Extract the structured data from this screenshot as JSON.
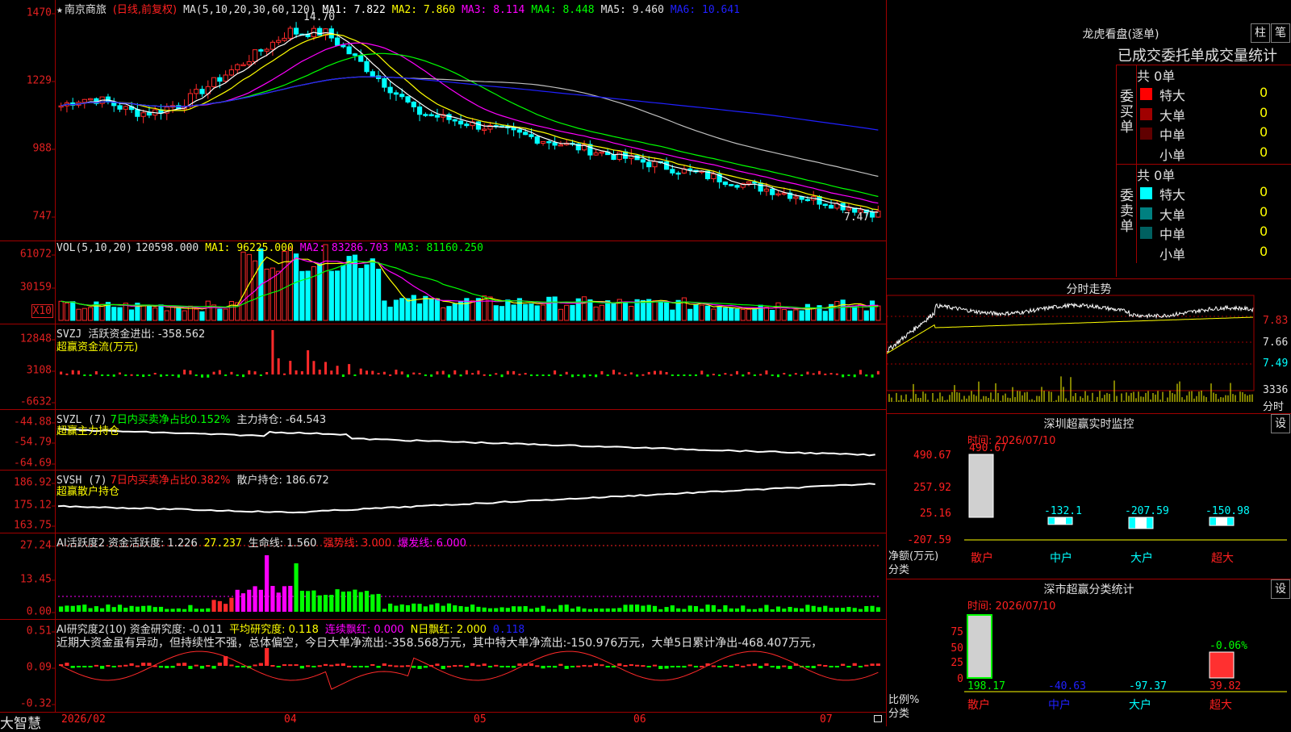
{
  "colors": {
    "up": "#ff2a2a",
    "down": "#00ffff",
    "ma1": "#ffffff",
    "ma2": "#ffff00",
    "ma3": "#ff00ff",
    "ma4": "#00ff00",
    "ma5": "#c0c0c0",
    "ma6": "#2020ff",
    "frame": "#a00000"
  },
  "main": {
    "stock_name": "南京商旅",
    "period": "(日线,前复权)",
    "ma_label": "MA(5,10,20,30,60,120)",
    "ma1": "MA1: 7.822",
    "ma2": "MA2: 7.860",
    "ma3": "MA3: 8.114",
    "ma4": "MA4: 8.448",
    "ma5": "MA5: 9.460",
    "ma6": "MA6: 10.641",
    "high_label": "14.70",
    "low_label": "7.47",
    "ticks": [
      "1470",
      "1229",
      "988",
      "747"
    ]
  },
  "vol": {
    "title": "VOL(5,10,20)",
    "value": "120598.000",
    "ma1": "MA1: 96225.000",
    "ma2": "MA2: 83286.703",
    "ma3": "MA3: 81160.250",
    "ticks": [
      "61072",
      "30159"
    ],
    "unit": "X10"
  },
  "svzj": {
    "title": "SVZJ",
    "line": "活跃资金进出: -358.562",
    "sub": "超赢资金流(万元)",
    "ticks": [
      "12848",
      "3108",
      "-6632"
    ]
  },
  "svzl": {
    "title": "SVZL (7)",
    "ratio": "7日内买卖净占比0.152%",
    "line": "主力持仓: -64.543",
    "sub": "超赢主力持仓",
    "ticks": [
      "-44.88",
      "-54.79",
      "-64.69"
    ]
  },
  "svsh": {
    "title": "SVSH (7)",
    "ratio": "7日内买卖净占比0.382%",
    "line": "散户持仓: 186.672",
    "sub": "超赢散户持仓",
    "ticks": [
      "186.92",
      "175.12",
      "163.75"
    ]
  },
  "ai1": {
    "title": "AI活跃度2",
    "v1": "资金活跃度: 1.226",
    "v2": "27.237",
    "v3": "生命线: 1.560",
    "v4": "强势线: 3.000",
    "v5": "爆发线: 6.000",
    "ticks": [
      "27.24",
      "13.45",
      "0.00"
    ]
  },
  "ai2": {
    "title": "AI研究度2(10)",
    "v1": "资金研究度: -0.011",
    "v2": "平均研究度: 0.118",
    "v3": "连续飘红: 0.000",
    "v4": "N日飘红: 2.000",
    "v5": "0.118",
    "comment": "近期大资金虽有异动，但持续性不强，总体偏空，今日大单净流出:-358.568万元，其中特大单净流出:-150.976万元，大单5日累计净出-468.407万元，",
    "ticks": [
      "0.51",
      "0.09",
      "-0.32"
    ]
  },
  "xaxis": [
    "2026/02",
    "04",
    "05",
    "06",
    "07"
  ],
  "brand": "大智慧",
  "lhb": {
    "title": "龙虎看盘(逐单)",
    "btn1": "柱",
    "btn2": "笔",
    "subtitle": "已成交委托单成交量统计",
    "buy_label": "委买单",
    "sell_label": "委卖单",
    "buy_total": "共 0单",
    "sell_total": "共 0单",
    "buy_rows": [
      {
        "cat": "特大",
        "cnt": "0",
        "pct": "0%",
        "color": "#ff0000"
      },
      {
        "cat": "大单",
        "cnt": "0",
        "pct": "0%",
        "color": "#a00000"
      },
      {
        "cat": "中单",
        "cnt": "0",
        "pct": "0%",
        "color": "#600000"
      },
      {
        "cat": "小单",
        "cnt": "0",
        "pct": "0%",
        "color": "#000000"
      }
    ],
    "sell_rows": [
      {
        "cat": "特大",
        "cnt": "0",
        "pct": "0%",
        "color": "#00ffff"
      },
      {
        "cat": "大单",
        "cnt": "0",
        "pct": "0%",
        "color": "#008080"
      },
      {
        "cat": "中单",
        "cnt": "0",
        "pct": "0%",
        "color": "#006060"
      },
      {
        "cat": "小单",
        "cnt": "0",
        "pct": "0%",
        "color": "#000000"
      }
    ]
  },
  "fenshi": {
    "title": "分时走势",
    "ticks": [
      "7.83",
      "7.66",
      "7.49",
      "3336"
    ],
    "unit": "分时"
  },
  "monitor": {
    "title": "深圳超赢实时监控",
    "btn": "设",
    "time": "时间: 2026/07/10",
    "ticks": [
      "490.67",
      "257.92",
      "25.16",
      "-207.59"
    ],
    "ylabel1": "净额(万元)",
    "ylabel2": "分类",
    "bars": [
      {
        "cat": "散户",
        "value": "490.67",
        "num": 490.67
      },
      {
        "cat": "中户",
        "value": "-132.1",
        "num": -132.1
      },
      {
        "cat": "大户",
        "value": "-207.59",
        "num": -207.59
      },
      {
        "cat": "超大",
        "value": "-150.98",
        "num": -150.98
      }
    ]
  },
  "classify": {
    "title": "深市超赢分类统计",
    "btn": "设",
    "time": "时间: 2026/07/10",
    "ticks": [
      "75",
      "50",
      "25",
      "0"
    ],
    "ylabel1": "比例%",
    "ylabel2": "分类",
    "pct_label": "-0.06%",
    "bars": [
      {
        "cat": "散户",
        "value": "198.17"
      },
      {
        "cat": "中户",
        "value": "-40.63"
      },
      {
        "cat": "大户",
        "value": "-97.37"
      },
      {
        "cat": "超大",
        "value": "39.82"
      }
    ]
  }
}
